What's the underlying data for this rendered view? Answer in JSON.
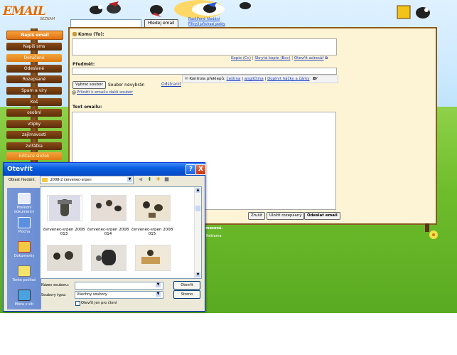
{
  "header": {
    "logo_text": "EMAIL",
    "logo_subtitle": "SEZNAM",
    "search_button": "Hledej email",
    "advanced_search_link": "Rozšířené hledání",
    "filter_link": "Filtry/i příchozí pošty"
  },
  "sidebar": {
    "compose": "Napiš email",
    "items": [
      "Napiš sms",
      "Doručené",
      "Odeslané",
      "Rozepsané",
      "Spam a viry",
      "Koš",
      "osobní",
      "vtipky",
      "zajímavosti",
      "zvířátka",
      "Editace složek"
    ]
  },
  "compose": {
    "to_label": "Komu (To):",
    "cc_link": "Kopie (Cc)",
    "bcc_link": "Skrytá kopie (Bcc)",
    "address_link": "Otevřít adresář",
    "subject_label": "Předmět:",
    "choose_file_button": "Vybrat soubor",
    "no_file_text": "Soubor nevybrán",
    "remove_link": "Odstranit",
    "attach_more_link": "Přiložit k emailu další soubor",
    "body_label": "Text emailu:",
    "spellcheck_label": "Kontrola překlepů:",
    "lang_czech": "čeština",
    "lang_english": "angličtina",
    "diacritics_link": "Doplnit háčky a čárky",
    "format_label": "B/",
    "cancel_button": "Zrušit",
    "save_draft_button": "Uložit rozepsaný",
    "send_button": "Odeslat email"
  },
  "footer": {
    "text": "omezená.",
    "link": "Reklama"
  },
  "dialog": {
    "title": "Otevřít",
    "help": "?",
    "close": "X",
    "look_in_label": "Oblast hledání:",
    "look_in_value": "2008-2 červenec-srpen",
    "places": [
      "Poslední dokumenty",
      "Plocha",
      "Dokumenty",
      "Tento počítač",
      "Místa v síti"
    ],
    "files": [
      {
        "name": "červenec-srpen 2008 013"
      },
      {
        "name": "červenec-srpen 2008 014"
      },
      {
        "name": "červenec-srpen 2008 015"
      },
      {
        "name": ""
      },
      {
        "name": ""
      },
      {
        "name": ""
      }
    ],
    "filename_label": "Název souboru:",
    "filename_value": "",
    "filetype_label": "Soubory typu:",
    "filetype_value": "Všechny soubory",
    "readonly_label": "Otevřít jen pro čtení",
    "open_button": "Otevřít",
    "cancel_button": "Storno"
  },
  "colors": {
    "accent_orange": "#e06f12",
    "wood": "#6b3d12",
    "link_blue": "#1a3fbf",
    "xp_blue": "#0a5fe0"
  }
}
